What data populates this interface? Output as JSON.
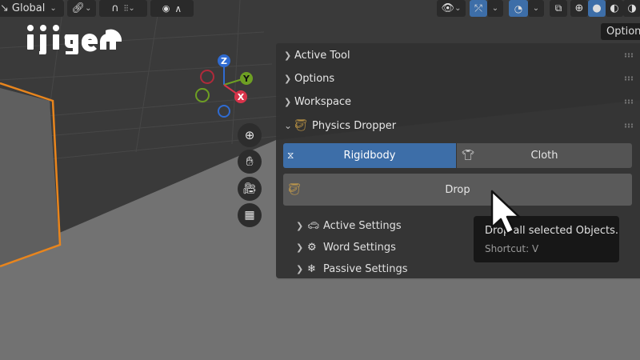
{
  "header": {
    "transform_orientation": "Global",
    "options_label": "Options"
  },
  "brand": {
    "logo_text": "ijigen"
  },
  "gizmo": {
    "z_label": "Z",
    "y_label": "Y",
    "x_label": "X"
  },
  "panel": {
    "sections": [
      {
        "label": "Active Tool"
      },
      {
        "label": "Options"
      },
      {
        "label": "Workspace"
      }
    ],
    "addon": {
      "title": "Physics Dropper",
      "mode_tabs": [
        {
          "label": "Rigidbody",
          "active": true
        },
        {
          "label": "Cloth",
          "active": false
        }
      ],
      "drop_label": "Drop",
      "subpanels": [
        {
          "label": "Active Settings"
        },
        {
          "label": "Word Settings"
        },
        {
          "label": "Passive Settings"
        }
      ]
    }
  },
  "tooltip": {
    "description": "Drop all selected Objects.",
    "shortcut": "Shortcut: V"
  },
  "colors": {
    "accent": "#3d6ea8",
    "selection_outline": "#e8851d",
    "axis_x": "#d8334a",
    "axis_y": "#6e9f23",
    "axis_z": "#2f6bd1"
  }
}
